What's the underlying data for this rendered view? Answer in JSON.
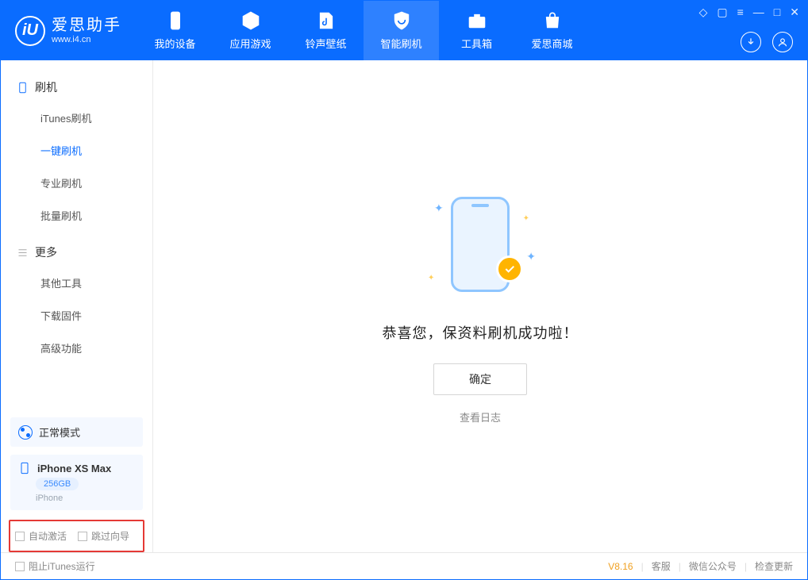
{
  "app": {
    "title": "爱思助手",
    "subtitle": "www.i4.cn"
  },
  "nav": [
    {
      "label": "我的设备"
    },
    {
      "label": "应用游戏"
    },
    {
      "label": "铃声壁纸"
    },
    {
      "label": "智能刷机"
    },
    {
      "label": "工具箱"
    },
    {
      "label": "爱思商城"
    }
  ],
  "sidebar": {
    "group_flash": "刷机",
    "items_flash": [
      "iTunes刷机",
      "一键刷机",
      "专业刷机",
      "批量刷机"
    ],
    "group_more": "更多",
    "items_more": [
      "其他工具",
      "下载固件",
      "高级功能"
    ]
  },
  "device": {
    "mode_label": "正常模式",
    "name": "iPhone XS Max",
    "capacity": "256GB",
    "type": "iPhone"
  },
  "options": {
    "auto_activate": "自动激活",
    "skip_guide": "跳过向导"
  },
  "main": {
    "success_msg": "恭喜您，保资料刷机成功啦！",
    "ok": "确定",
    "view_log": "查看日志"
  },
  "footer": {
    "stop_itunes": "阻止iTunes运行",
    "version": "V8.16",
    "support": "客服",
    "wechat": "微信公众号",
    "check_update": "检查更新"
  }
}
